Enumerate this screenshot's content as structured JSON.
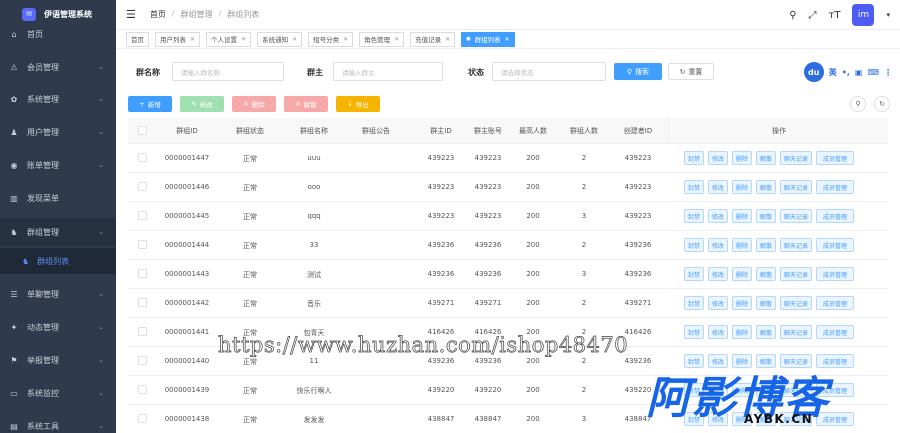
{
  "app": {
    "title": "伊语管理系统"
  },
  "sidebar": {
    "items": [
      {
        "label": "首页",
        "icon": "home-icon",
        "glyph": "⌂",
        "has_children": false
      },
      {
        "label": "会员管理",
        "icon": "user-icon",
        "glyph": "⚠",
        "has_children": true
      },
      {
        "label": "系统管理",
        "icon": "gear-icon",
        "glyph": "✿",
        "has_children": true
      },
      {
        "label": "用户管理",
        "icon": "users-icon",
        "glyph": "♟",
        "has_children": true
      },
      {
        "label": "账单管理",
        "icon": "bill-icon",
        "glyph": "◉",
        "has_children": true
      },
      {
        "label": "发现菜单",
        "icon": "discover-icon",
        "glyph": "▥",
        "has_children": false
      },
      {
        "label": "群组管理",
        "icon": "group-icon",
        "glyph": "♞",
        "has_children": true
      },
      {
        "label": "单聊管理",
        "icon": "chat-icon",
        "glyph": "☰",
        "has_children": true
      },
      {
        "label": "动态管理",
        "icon": "moments-icon",
        "glyph": "✦",
        "has_children": true
      },
      {
        "label": "举报管理",
        "icon": "report-icon",
        "glyph": "⚑",
        "has_children": true
      },
      {
        "label": "系统监控",
        "icon": "monitor-icon",
        "glyph": "▭",
        "has_children": true
      },
      {
        "label": "系统工具",
        "icon": "tools-icon",
        "glyph": "▤",
        "has_children": true
      }
    ],
    "active_sub": {
      "label": "群组列表",
      "icon": "group-list-icon"
    }
  },
  "header": {
    "breadcrumb": [
      "首页",
      "群组管理",
      "群组列表"
    ],
    "icons": [
      "search-icon",
      "fullscreen-icon",
      "font-size-icon"
    ],
    "avatar_text": "im"
  },
  "tabs": [
    {
      "label": "首页",
      "closable": false,
      "active": false
    },
    {
      "label": "用户列表",
      "closable": true,
      "active": false
    },
    {
      "label": "个人设置",
      "closable": true,
      "active": false
    },
    {
      "label": "系统通知",
      "closable": true,
      "active": false
    },
    {
      "label": "短号分类",
      "closable": true,
      "active": false
    },
    {
      "label": "角色管理",
      "closable": true,
      "active": false
    },
    {
      "label": "充值记录",
      "closable": true,
      "active": false
    },
    {
      "label": "群组列表",
      "closable": true,
      "active": true
    }
  ],
  "filters": {
    "group_name_label": "群名称",
    "group_name_placeholder": "请输入群名称",
    "owner_label": "群主",
    "owner_placeholder": "请输入群主",
    "status_label": "状态",
    "status_placeholder": "请选择状态",
    "search_label": "搜索",
    "reset_label": "重置"
  },
  "du_widget": {
    "logo_text": "du",
    "lang": "英"
  },
  "toolbar": {
    "buttons": [
      {
        "label": "新增",
        "color": "#409eff",
        "icon": "+"
      },
      {
        "label": "修改",
        "color": "#a0e0b0",
        "icon": "✎"
      },
      {
        "label": "删除",
        "color": "#f7a8a8",
        "icon": "✕"
      },
      {
        "label": "解散",
        "color": "#f7a8a8",
        "icon": "✕"
      },
      {
        "label": "导出",
        "color": "#f5b400",
        "icon": "↓"
      }
    ]
  },
  "table": {
    "columns": [
      "群组ID",
      "群组状态",
      "群组名称",
      "群组公告",
      "群主ID",
      "群主账号",
      "最高人数",
      "群组人数",
      "创建者ID",
      "操作"
    ],
    "op_buttons": [
      "封禁",
      "修改",
      "删除",
      "解散",
      "聊天记录",
      "成员管理"
    ],
    "rows": [
      {
        "id": "0000001447",
        "status": "正常",
        "name": "uuu",
        "notice": "",
        "owner_id": "439223",
        "owner_account": "439223",
        "max": "200",
        "count": "2",
        "creator": "439223"
      },
      {
        "id": "0000001446",
        "status": "正常",
        "name": "ooo",
        "notice": "",
        "owner_id": "439223",
        "owner_account": "439223",
        "max": "200",
        "count": "2",
        "creator": "439223"
      },
      {
        "id": "0000001445",
        "status": "正常",
        "name": "qqq",
        "notice": "",
        "owner_id": "439223",
        "owner_account": "439223",
        "max": "200",
        "count": "3",
        "creator": "439223"
      },
      {
        "id": "0000001444",
        "status": "正常",
        "name": "33",
        "notice": "",
        "owner_id": "439236",
        "owner_account": "439236",
        "max": "200",
        "count": "2",
        "creator": "439236"
      },
      {
        "id": "0000001443",
        "status": "正常",
        "name": "测试",
        "notice": "",
        "owner_id": "439236",
        "owner_account": "439236",
        "max": "200",
        "count": "3",
        "creator": "439236"
      },
      {
        "id": "0000001442",
        "status": "正常",
        "name": "音乐",
        "notice": "",
        "owner_id": "439271",
        "owner_account": "439271",
        "max": "200",
        "count": "2",
        "creator": "439271"
      },
      {
        "id": "0000001441",
        "status": "正常",
        "name": "包青天",
        "notice": "",
        "owner_id": "416426",
        "owner_account": "416426",
        "max": "200",
        "count": "2",
        "creator": "416426"
      },
      {
        "id": "0000001440",
        "status": "正常",
        "name": "11",
        "notice": "",
        "owner_id": "439236",
        "owner_account": "439236",
        "max": "200",
        "count": "2",
        "creator": "439236"
      },
      {
        "id": "0000001439",
        "status": "正常",
        "name": "快乐行啊人",
        "notice": "",
        "owner_id": "439220",
        "owner_account": "439220",
        "max": "200",
        "count": "2",
        "creator": "439220"
      },
      {
        "id": "0000001438",
        "status": "正常",
        "name": "发发发",
        "notice": "",
        "owner_id": "438847",
        "owner_account": "438847",
        "max": "200",
        "count": "3",
        "creator": "438847"
      }
    ]
  },
  "watermarks": {
    "url_text": "https://www.huzhan.com/ishop48470",
    "brand_big": "阿影博客",
    "brand_small": "AYBK.CN"
  }
}
